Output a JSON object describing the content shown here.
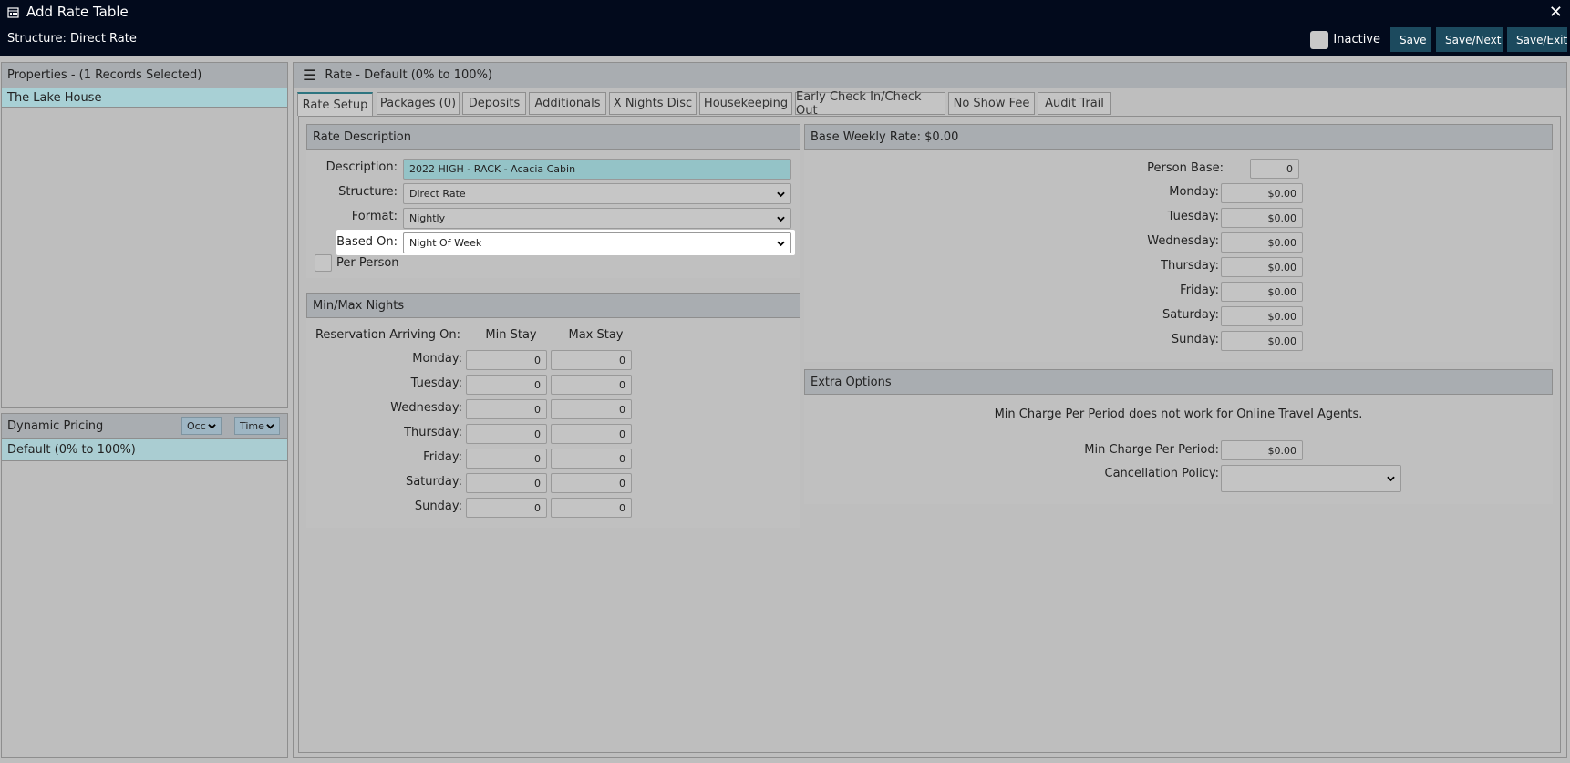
{
  "window": {
    "title": "Add Rate Table",
    "subtitle": "Structure: Direct Rate",
    "inactive_label": "Inactive",
    "buttons": {
      "save": "Save",
      "save_next": "Save/Next",
      "save_exit": "Save/Exit"
    }
  },
  "properties": {
    "header": "Properties - (1 Records Selected)",
    "selected_item": "The Lake House"
  },
  "dynamic_pricing": {
    "header": "Dynamic Pricing",
    "occ_label": "Occ",
    "time_label": "Time",
    "selected_item": "Default (0% to 100%)"
  },
  "rate": {
    "header": "Rate - Default (0% to 100%)",
    "tabs": [
      "Rate Setup",
      "Packages (0)",
      "Deposits",
      "Additionals",
      "X Nights Disc",
      "Housekeeping",
      "Early Check In/Check Out",
      "No Show Fee",
      "Audit Trail"
    ],
    "active_tab": "Rate Setup"
  },
  "rate_description": {
    "header": "Rate Description",
    "description_label": "Description:",
    "description_value": "2022 HIGH - RACK - Acacia Cabin",
    "structure_label": "Structure:",
    "structure_value": "Direct Rate",
    "format_label": "Format:",
    "format_value": "Nightly",
    "based_on_label": "Based On:",
    "based_on_value": "Night Of Week",
    "per_person_label": "Per Person"
  },
  "min_max": {
    "header": "Min/Max Nights",
    "arriving_label": "Reservation Arriving On:",
    "min_label": "Min Stay",
    "max_label": "Max Stay",
    "rows": [
      {
        "day": "Monday:",
        "min": "0",
        "max": "0"
      },
      {
        "day": "Tuesday:",
        "min": "0",
        "max": "0"
      },
      {
        "day": "Wednesday:",
        "min": "0",
        "max": "0"
      },
      {
        "day": "Thursday:",
        "min": "0",
        "max": "0"
      },
      {
        "day": "Friday:",
        "min": "0",
        "max": "0"
      },
      {
        "day": "Saturday:",
        "min": "0",
        "max": "0"
      },
      {
        "day": "Sunday:",
        "min": "0",
        "max": "0"
      }
    ]
  },
  "base_weekly": {
    "header": "Base Weekly Rate: $0.00",
    "person_base_label": "Person Base:",
    "person_base_value": "0",
    "rows": [
      {
        "day": "Monday:",
        "value": "$0.00"
      },
      {
        "day": "Tuesday:",
        "value": "$0.00"
      },
      {
        "day": "Wednesday:",
        "value": "$0.00"
      },
      {
        "day": "Thursday:",
        "value": "$0.00"
      },
      {
        "day": "Friday:",
        "value": "$0.00"
      },
      {
        "day": "Saturday:",
        "value": "$0.00"
      },
      {
        "day": "Sunday:",
        "value": "$0.00"
      }
    ]
  },
  "extra_options": {
    "header": "Extra Options",
    "note": "Min Charge Per Period does not work for Online Travel Agents.",
    "min_charge_label": "Min Charge Per Period:",
    "min_charge_value": "$0.00",
    "cancellation_label": "Cancellation Policy:",
    "cancellation_value": ""
  }
}
